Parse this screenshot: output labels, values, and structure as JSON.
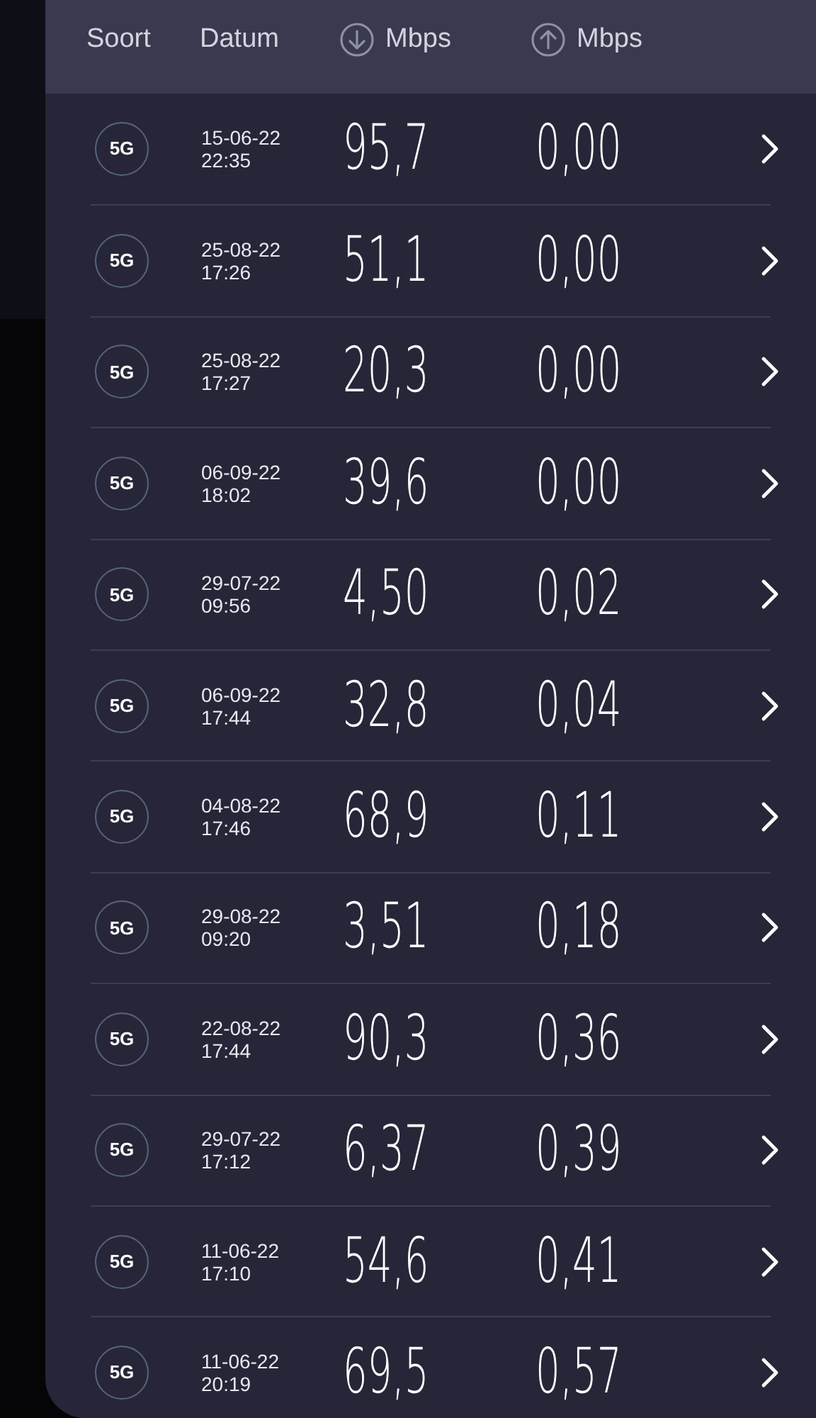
{
  "header": {
    "type_label": "Soort",
    "date_label": "Datum",
    "download_label": "Mbps",
    "upload_label": "Mbps"
  },
  "rows": [
    {
      "network": "5G",
      "date": "15-06-22",
      "time": "22:35",
      "download": "95,7",
      "upload": "0,00"
    },
    {
      "network": "5G",
      "date": "25-08-22",
      "time": "17:26",
      "download": "51,1",
      "upload": "0,00"
    },
    {
      "network": "5G",
      "date": "25-08-22",
      "time": "17:27",
      "download": "20,3",
      "upload": "0,00"
    },
    {
      "network": "5G",
      "date": "06-09-22",
      "time": "18:02",
      "download": "39,6",
      "upload": "0,00"
    },
    {
      "network": "5G",
      "date": "29-07-22",
      "time": "09:56",
      "download": "4,50",
      "upload": "0,02"
    },
    {
      "network": "5G",
      "date": "06-09-22",
      "time": "17:44",
      "download": "32,8",
      "upload": "0,04"
    },
    {
      "network": "5G",
      "date": "04-08-22",
      "time": "17:46",
      "download": "68,9",
      "upload": "0,11"
    },
    {
      "network": "5G",
      "date": "29-08-22",
      "time": "09:20",
      "download": "3,51",
      "upload": "0,18"
    },
    {
      "network": "5G",
      "date": "22-08-22",
      "time": "17:44",
      "download": "90,3",
      "upload": "0,36"
    },
    {
      "network": "5G",
      "date": "29-07-22",
      "time": "17:12",
      "download": "6,37",
      "upload": "0,39"
    },
    {
      "network": "5G",
      "date": "11-06-22",
      "time": "17:10",
      "download": "54,6",
      "upload": "0,41"
    },
    {
      "network": "5G",
      "date": "11-06-22",
      "time": "20:19",
      "download": "69,5",
      "upload": "0,57"
    }
  ]
}
